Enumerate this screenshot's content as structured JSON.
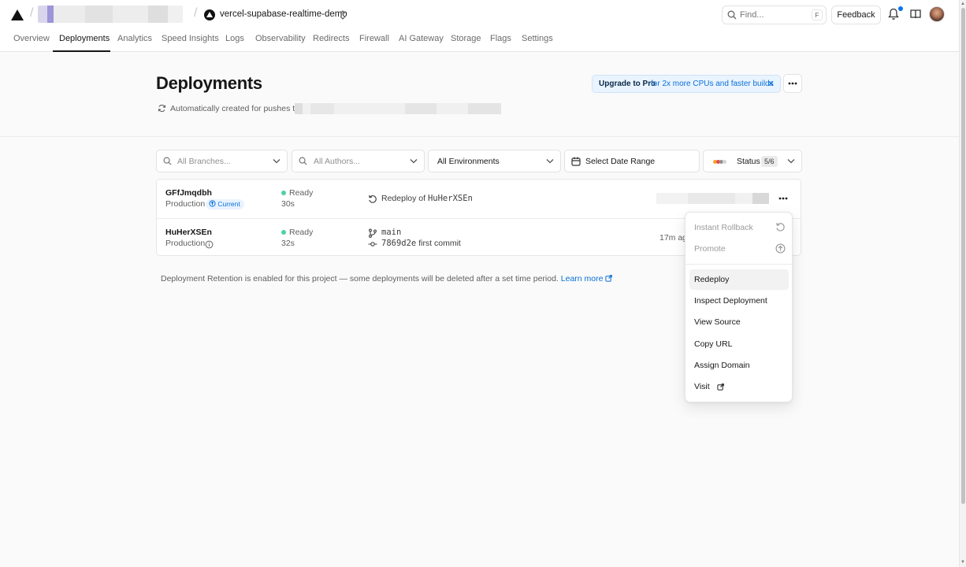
{
  "header": {
    "project_name": "vercel-supabase-realtime-demo",
    "search": {
      "placeholder": "Find...",
      "shortcut": "F"
    },
    "feedback_label": "Feedback"
  },
  "tabs": [
    {
      "label": "Overview"
    },
    {
      "label": "Deployments",
      "active": true
    },
    {
      "label": "Analytics"
    },
    {
      "label": "Speed Insights"
    },
    {
      "label": "Logs"
    },
    {
      "label": "Observability"
    },
    {
      "label": "Redirects"
    },
    {
      "label": "Firewall"
    },
    {
      "label": "AI Gateway"
    },
    {
      "label": "Storage"
    },
    {
      "label": "Flags"
    },
    {
      "label": "Settings"
    }
  ],
  "page": {
    "title": "Deployments",
    "auto_created_text": "Automatically created for pushes to",
    "upgrade": {
      "strong": "Upgrade to Pro",
      "rest": "for 2x more CPUs and faster builds",
      "close": "✕"
    }
  },
  "filters": {
    "branches_placeholder": "All Branches...",
    "authors_placeholder": "All Authors...",
    "environments": "All Environments",
    "date_range": "Select Date Range",
    "status_label": "Status",
    "status_count": "5/6"
  },
  "deployments": [
    {
      "id": "GFfJmqdbh",
      "environment": "Production",
      "badge": "Current",
      "status": "Ready",
      "duration": "30s",
      "source_text": "Redeploy of",
      "source_ref": "HuHerXSEn"
    },
    {
      "id": "HuHerXSEn",
      "environment": "Production",
      "status": "Ready",
      "duration": "32s",
      "branch": "main",
      "commit_sha": "7869d2e",
      "commit_message": "first commit",
      "age": "17m ago"
    }
  ],
  "retention": {
    "text": "Deployment Retention is enabled for this project — some deployments will be deleted after a set time period.",
    "link": "Learn more"
  },
  "menu": {
    "items": [
      {
        "label": "Instant Rollback",
        "disabled": true,
        "icon": "rollback-icon"
      },
      {
        "label": "Promote",
        "disabled": true,
        "icon": "promote-icon"
      },
      {
        "label": "Redeploy",
        "highlighted": true
      },
      {
        "label": "Inspect Deployment"
      },
      {
        "label": "View Source"
      },
      {
        "label": "Copy URL"
      },
      {
        "label": "Assign Domain"
      },
      {
        "label": "Visit",
        "icon": "external-link-icon"
      }
    ]
  },
  "colors": {
    "ready": "#4fd1a5",
    "accent": "#0a6fd8",
    "notification_dot": "#0a72ef"
  }
}
